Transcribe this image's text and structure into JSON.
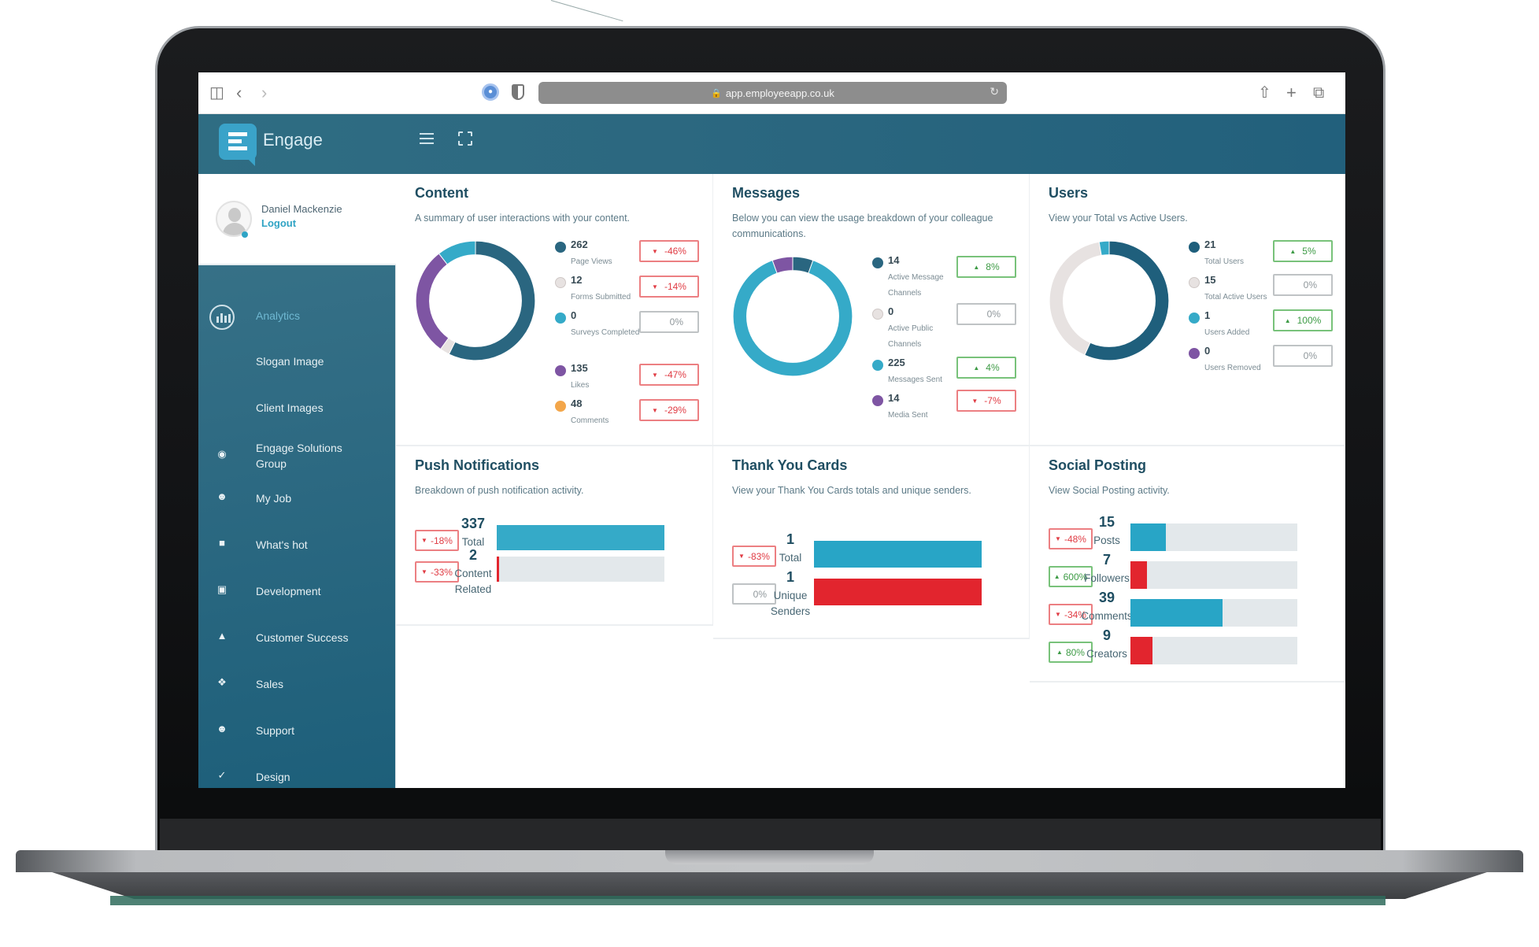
{
  "browser": {
    "url": "app.employeeapp.co.uk",
    "icons": [
      "sidebar-toggle-icon",
      "back-icon",
      "forward-icon",
      "password-manager-icon",
      "shield-icon",
      "lock-icon",
      "translate-icon",
      "reload-icon",
      "share-icon",
      "new-tab-icon",
      "tabs-overview-icon"
    ]
  },
  "app": {
    "brand": "Engage",
    "header_icons": [
      "menu-icon",
      "fullscreen-icon"
    ]
  },
  "user": {
    "name": "Daniel Mackenzie",
    "logout_label": "Logout"
  },
  "sidebar": {
    "items": [
      {
        "label": "Analytics",
        "icon": "analytics-icon",
        "active": true
      },
      {
        "label": "Slogan Image",
        "icon": ""
      },
      {
        "label": "Client Images",
        "icon": ""
      },
      {
        "label": "Engage Solutions Group",
        "icon": "engage-logo-icon"
      },
      {
        "label": "My Job",
        "icon": "person-icon"
      },
      {
        "label": "What's hot",
        "icon": "chat-bubble-icon"
      },
      {
        "label": "Development",
        "icon": "laptop-icon"
      },
      {
        "label": "Customer Success",
        "icon": "thumbs-up-icon"
      },
      {
        "label": "Sales",
        "icon": "handshake-icon"
      },
      {
        "label": "Support",
        "icon": "support-agent-icon"
      },
      {
        "label": "Design",
        "icon": "brush-icon"
      }
    ]
  },
  "colors": {
    "dark": "#2a6680",
    "light": "#e7e2e1",
    "cyan": "#35aac8",
    "purple": "#7e55a3",
    "orange": "#f3a64a",
    "red": "#e2252e",
    "up": "#3d9b45",
    "down": "#e03b43"
  },
  "cards": {
    "content": {
      "title": "Content",
      "subtitle": "A summary of user interactions with your content.",
      "legend": [
        {
          "value": "262",
          "label": "Page Views",
          "color": "#2a6680",
          "change": "-46%",
          "trend": "down"
        },
        {
          "value": "12",
          "label": "Forms Submitted",
          "color": "#e7e2e1",
          "change": "-14%",
          "trend": "down"
        },
        {
          "value": "0",
          "label": "Surveys Completed",
          "color": "#35aac8",
          "change": "0%",
          "trend": "flat"
        },
        {
          "value": "135",
          "label": "Likes",
          "color": "#7e55a3",
          "change": "-47%",
          "trend": "down"
        },
        {
          "value": "48",
          "label": "Comments",
          "color": "#f3a64a",
          "change": "-29%",
          "trend": "down"
        }
      ]
    },
    "messages": {
      "title": "Messages",
      "subtitle": "Below you can view the usage breakdown of your colleague communications.",
      "legend": [
        {
          "value": "14",
          "label": "Active Message Channels",
          "color": "#2a6680",
          "change": "8%",
          "trend": "up"
        },
        {
          "value": "0",
          "label": "Active Public Channels",
          "color": "#e7e2e1",
          "change": "0%",
          "trend": "flat"
        },
        {
          "value": "225",
          "label": "Messages Sent",
          "color": "#35aac8",
          "change": "4%",
          "trend": "up"
        },
        {
          "value": "14",
          "label": "Media Sent",
          "color": "#7e55a3",
          "change": "-7%",
          "trend": "down"
        }
      ]
    },
    "users": {
      "title": "Users",
      "subtitle": "View your Total vs Active Users.",
      "legend": [
        {
          "value": "21",
          "label": "Total Users",
          "color": "#1f5f7c",
          "change": "5%",
          "trend": "up"
        },
        {
          "value": "15",
          "label": "Total Active Users",
          "color": "#e7e2e1",
          "change": "0%",
          "trend": "flat"
        },
        {
          "value": "1",
          "label": "Users Added",
          "color": "#35aac8",
          "change": "100%",
          "trend": "up"
        },
        {
          "value": "0",
          "label": "Users Removed",
          "color": "#7e55a3",
          "change": "0%",
          "trend": "flat"
        }
      ]
    },
    "push": {
      "title": "Push Notifications",
      "subtitle": "Breakdown of push notification activity.",
      "rows": [
        {
          "value": "337",
          "label": "Total",
          "change": "-18%",
          "trend": "down",
          "fraction": 1.0,
          "color": "#35aac8"
        },
        {
          "value": "2",
          "label": "Content Related",
          "change": "-33%",
          "trend": "down",
          "fraction": 0.006,
          "color": "#e2252e"
        }
      ]
    },
    "thanks": {
      "title": "Thank You Cards",
      "subtitle": "View your Thank You Cards totals and unique senders.",
      "rows": [
        {
          "value": "1",
          "label": "Total",
          "change": "-83%",
          "trend": "down",
          "fraction": 1.0,
          "color": "#28a5c6"
        },
        {
          "value": "1",
          "label": "Unique Senders",
          "change": "0%",
          "trend": "flat",
          "fraction": 1.0,
          "color": "#e2252e"
        }
      ]
    },
    "social": {
      "title": "Social Posting",
      "subtitle": "View Social Posting activity.",
      "rows": [
        {
          "value": "15",
          "label": "Posts",
          "change": "-48%",
          "trend": "down",
          "fraction": 0.21,
          "color": "#28a5c6"
        },
        {
          "value": "7",
          "label": "Followers",
          "change": "600%",
          "trend": "up",
          "fraction": 0.1,
          "color": "#e2252e"
        },
        {
          "value": "39",
          "label": "Comments",
          "change": "-34%",
          "trend": "down",
          "fraction": 0.55,
          "color": "#28a5c6"
        },
        {
          "value": "9",
          "label": "Creators",
          "change": "80%",
          "trend": "up",
          "fraction": 0.13,
          "color": "#e2252e"
        }
      ]
    }
  },
  "chart_data": [
    {
      "type": "pie",
      "title": "Content",
      "categories": [
        "Page Views",
        "Forms Submitted",
        "Likes",
        "Comments"
      ],
      "values": [
        262,
        12,
        135,
        48
      ],
      "segment_colors": [
        "#2a6680",
        "#e7e2e1",
        "#7e55a3",
        "#35aac8"
      ]
    },
    {
      "type": "pie",
      "title": "Messages",
      "categories": [
        "Active Message Channels",
        "Messages Sent",
        "Media Sent"
      ],
      "values": [
        14,
        225,
        14
      ],
      "segment_colors": [
        "#2a6680",
        "#35aac8",
        "#7e55a3"
      ]
    },
    {
      "type": "pie",
      "title": "Users",
      "categories": [
        "Total Users",
        "Total Active Users",
        "Users Added"
      ],
      "values": [
        21,
        15,
        1
      ],
      "segment_colors": [
        "#1f5f7c",
        "#e7e2e1",
        "#35aac8"
      ]
    },
    {
      "type": "bar",
      "title": "Push Notifications",
      "categories": [
        "Total",
        "Content Related"
      ],
      "values": [
        337,
        2
      ]
    },
    {
      "type": "bar",
      "title": "Thank You Cards",
      "categories": [
        "Total",
        "Unique Senders"
      ],
      "values": [
        1,
        1
      ]
    },
    {
      "type": "bar",
      "title": "Social Posting",
      "categories": [
        "Posts",
        "Followers",
        "Comments",
        "Creators"
      ],
      "values": [
        15,
        7,
        39,
        9
      ]
    }
  ]
}
